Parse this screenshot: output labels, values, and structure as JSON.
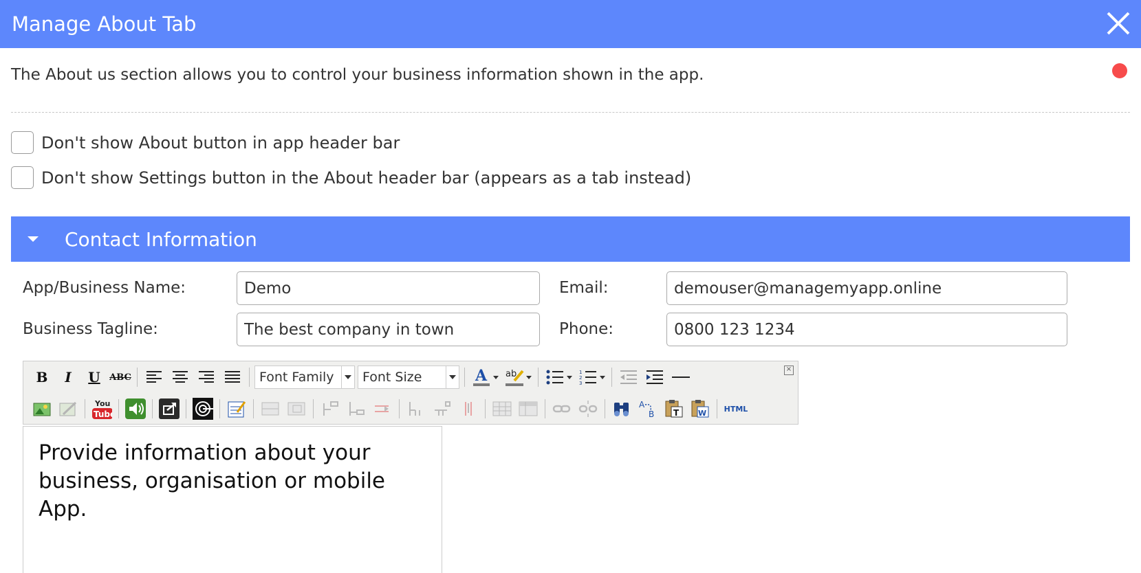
{
  "window": {
    "title": "Manage About Tab",
    "close_icon": "close-icon"
  },
  "intro": {
    "text": "The About us section allows you to control your business information shown in the app.",
    "status_color": "#f74b4b"
  },
  "options": [
    {
      "label": "Don't show About button in app header bar",
      "checked": false
    },
    {
      "label": "Don't show Settings button in the About header bar (appears as a tab instead)",
      "checked": false
    }
  ],
  "section": {
    "title": "Contact Information",
    "expanded": true,
    "color": "#5d87fc"
  },
  "fields": {
    "business_name": {
      "label": "App/Business Name:",
      "value": "Demo"
    },
    "email": {
      "label": "Email:",
      "value": "demouser@managemyapp.online"
    },
    "tagline": {
      "label": "Business Tagline:",
      "value": "The best company in town"
    },
    "phone": {
      "label": "Phone:",
      "value": "0800 123 1234"
    }
  },
  "editor": {
    "font_family_label": "Font Family",
    "font_size_label": "Font Size",
    "html_label": "HTML",
    "content": "Provide information about your business, organisation or mobile App."
  }
}
